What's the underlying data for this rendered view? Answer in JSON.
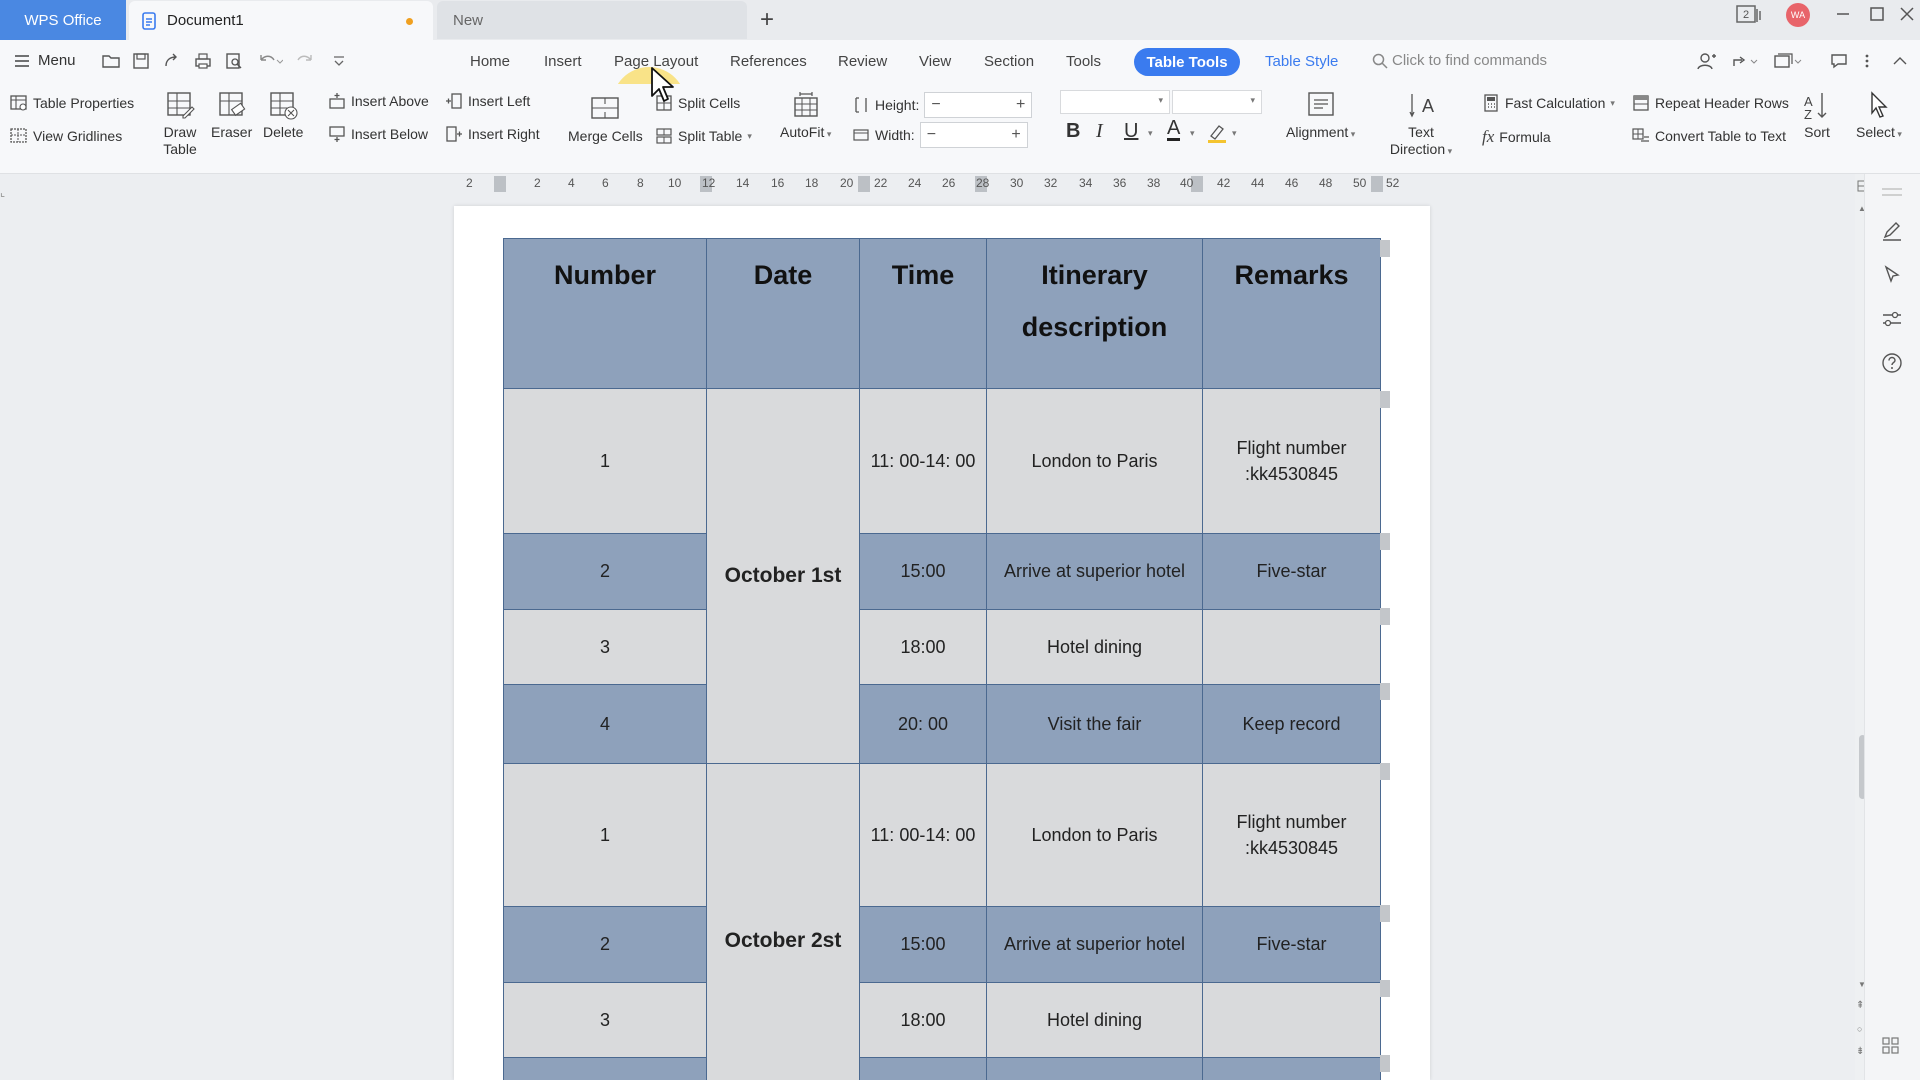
{
  "titlebar": {
    "wps_tab": "WPS Office",
    "doc_tab": "Document1",
    "new_tab": "New",
    "add_tab": "+",
    "badge": "2",
    "avatar": "WA"
  },
  "menubar": {
    "menu_label": "Menu",
    "tabs": [
      "Home",
      "Insert",
      "Page Layout",
      "References",
      "Review",
      "View",
      "Section",
      "Tools",
      "Table Tools",
      "Table Style"
    ],
    "search_placeholder": "Click to find commands"
  },
  "ribbon": {
    "table_properties": "Table Properties",
    "view_gridlines": "View Gridlines",
    "draw_table": "Draw Table",
    "eraser": "Eraser",
    "delete": "Delete",
    "insert_above": "Insert Above",
    "insert_below": "Insert Below",
    "insert_left": "Insert Left",
    "insert_right": "Insert Right",
    "merge_cells": "Merge Cells",
    "split_cells": "Split Cells",
    "split_table": "Split Table",
    "autofit": "AutoFit",
    "height": "Height:",
    "width": "Width:",
    "alignment": "Alignment",
    "text_direction": "Text Direction",
    "fast_calculation": "Fast Calculation",
    "formula": "Formula",
    "repeat_header_rows": "Repeat Header Rows",
    "convert_table_to_text": "Convert Table to Text",
    "sort": "Sort",
    "select": "Select"
  },
  "ruler": {
    "ticks": [
      "2",
      "2",
      "4",
      "6",
      "8",
      "10",
      "12",
      "14",
      "16",
      "18",
      "20",
      "22",
      "24",
      "26",
      "28",
      "30",
      "32",
      "34",
      "36",
      "38",
      "40",
      "42",
      "44",
      "46",
      "48",
      "50",
      "52"
    ]
  },
  "table": {
    "headers": [
      "Number",
      "Date",
      "Time",
      "Itinerary description",
      "Remarks"
    ],
    "group1": {
      "date": "October 1st",
      "rows": [
        {
          "number": "1",
          "time": "11:  00-14:  00",
          "itinerary": "London to Paris",
          "remarks": "Flight number :kk4530845"
        },
        {
          "number": "2",
          "time": "15:00",
          "itinerary": "Arrive at superior hotel",
          "remarks": "Five-star"
        },
        {
          "number": "3",
          "time": "18:00",
          "itinerary": "Hotel dining",
          "remarks": ""
        },
        {
          "number": "4",
          "time": "20:  00",
          "itinerary": "Visit the fair",
          "remarks": "Keep record"
        }
      ]
    },
    "group2": {
      "date": "October 2st",
      "rows": [
        {
          "number": "1",
          "time": "11:  00-14:  00",
          "itinerary": "London to Paris",
          "remarks": "Flight number :kk4530845"
        },
        {
          "number": "2",
          "time": "15:00",
          "itinerary": "Arrive at superior hotel",
          "remarks": "Five-star"
        },
        {
          "number": "3",
          "time": "18:00",
          "itinerary": "Hotel dining",
          "remarks": ""
        }
      ]
    }
  },
  "colors": {
    "accent": "#3a7bef",
    "header_fill": "#8ea1bb",
    "light_row": "#d9dadc",
    "border": "#4b6990"
  }
}
